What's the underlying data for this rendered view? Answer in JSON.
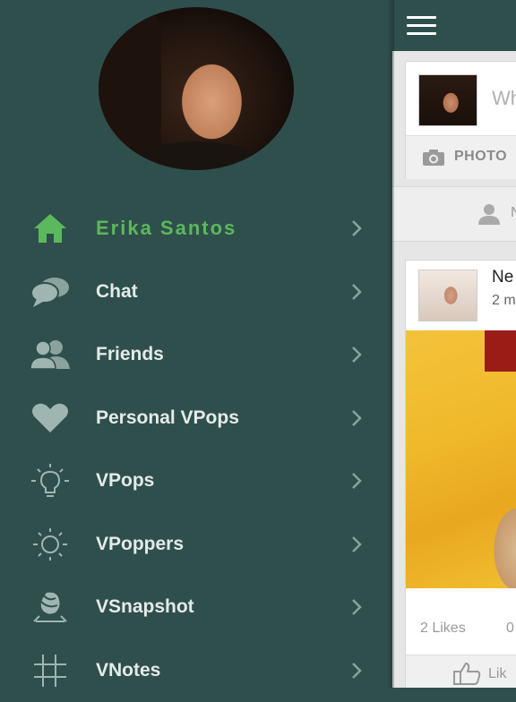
{
  "sidebar": {
    "items": [
      {
        "label": "Erika Santos",
        "icon": "home-icon"
      },
      {
        "label": "Chat",
        "icon": "chat-bubbles-icon"
      },
      {
        "label": "Friends",
        "icon": "friends-icon"
      },
      {
        "label": "Personal VPops",
        "icon": "heart-icon"
      },
      {
        "label": "VPops",
        "icon": "lightbulb-icon"
      },
      {
        "label": "VPoppers",
        "icon": "sun-icon"
      },
      {
        "label": "VSnapshot",
        "icon": "snapshot-icon"
      },
      {
        "label": "VNotes",
        "icon": "hash-icon"
      }
    ],
    "active_color": "#5cb85c",
    "background_color": "#2f4f4c"
  },
  "content": {
    "post_placeholder": "Wh",
    "photo_label": "PHOTO",
    "friend_bar_text": "N",
    "feed": {
      "name": "Ne",
      "time": "2 m",
      "likes": "2 Likes",
      "comments": "0",
      "like_button": "Lik"
    }
  }
}
